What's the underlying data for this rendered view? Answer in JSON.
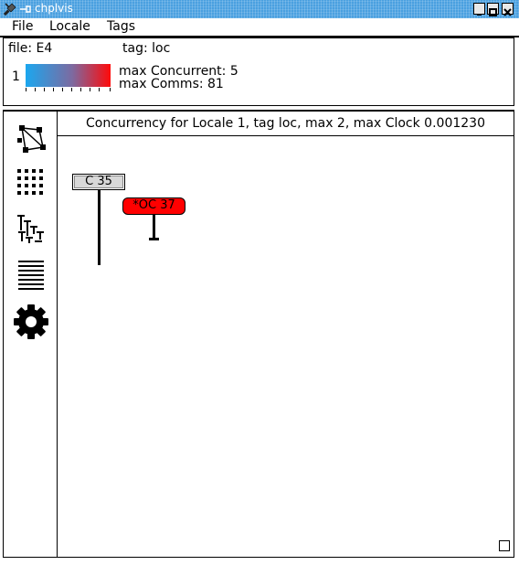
{
  "window": {
    "title": "chplvis",
    "app_icon": "tools-icon",
    "buttons": [
      "minimize-icon",
      "maximize-icon",
      "close-icon"
    ]
  },
  "menu": {
    "items": [
      {
        "label": "File"
      },
      {
        "label": "Locale"
      },
      {
        "label": "Tags"
      }
    ]
  },
  "info": {
    "file_label": "file: E4",
    "tag_label": "tag: loc",
    "locale_number": "1",
    "max_concurrent": "max Concurrent: 5",
    "max_comms": "max Comms: 81",
    "gradient_colors": [
      "#1ba7ef",
      "#ff0a0a"
    ]
  },
  "sidebar": {
    "icons": [
      "network-graph-icon",
      "grid-view-icon",
      "tree-view-icon",
      "list-view-icon",
      "settings-gear-icon"
    ]
  },
  "main": {
    "header": "Concurrency for Locale 1, tag loc, max 2, max Clock 0.001230",
    "tags": [
      {
        "label": "C 35",
        "color": "#d8d8d8"
      },
      {
        "label": "*OC 37",
        "color": "#ff0000"
      }
    ]
  }
}
